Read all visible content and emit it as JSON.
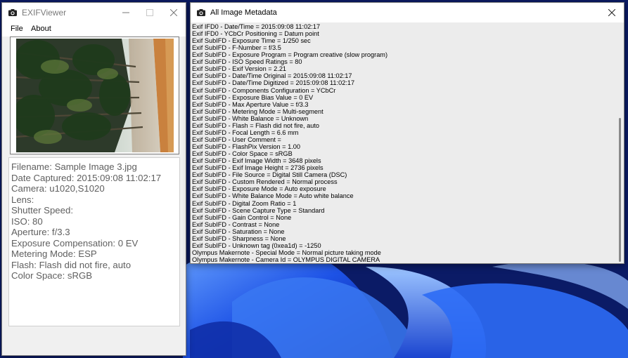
{
  "colors": {
    "wallpaper_dark": "#0a1a5c",
    "wallpaper_light": "#2a6cf0",
    "window_bg": "#f3f3f3",
    "meta_bg": "#ececec"
  },
  "exif_viewer": {
    "title": "EXIFViewer",
    "app_icon": "camera-icon",
    "menu": [
      "File",
      "About"
    ],
    "info": [
      "Filename: Sample Image 3.jpg",
      "Date Captured: 2015:09:08 11:02:17",
      "Camera: u1020,S1020",
      "Lens:",
      "Shutter Speed:",
      "ISO: 80",
      "Aperture: f/3.3",
      "Exposure Compensation: 0 EV",
      "Metering Mode: ESP",
      "Flash: Flash did not fire, auto",
      "Color Space: sRGB"
    ]
  },
  "metadata_window": {
    "title": "All Image Metadata",
    "app_icon": "camera-icon",
    "lines": [
      "Exif IFD0 - Date/Time = 2015:09:08 11:02:17",
      "Exif IFD0 - YCbCr Positioning = Datum point",
      "Exif SubIFD - Exposure Time = 1/250 sec",
      "Exif SubIFD - F-Number = f/3.5",
      "Exif SubIFD - Exposure Program = Program creative (slow program)",
      "Exif SubIFD - ISO Speed Ratings = 80",
      "Exif SubIFD - Exif Version = 2.21",
      "Exif SubIFD - Date/Time Original = 2015:09:08 11:02:17",
      "Exif SubIFD - Date/Time Digitized = 2015:09:08 11:02:17",
      "Exif SubIFD - Components Configuration = YCbCr",
      "Exif SubIFD - Exposure Bias Value = 0 EV",
      "Exif SubIFD - Max Aperture Value = f/3.3",
      "Exif SubIFD - Metering Mode = Multi-segment",
      "Exif SubIFD - White Balance = Unknown",
      "Exif SubIFD - Flash = Flash did not fire, auto",
      "Exif SubIFD - Focal Length = 6.6 mm",
      "Exif SubIFD - User Comment =",
      "Exif SubIFD - FlashPix Version = 1.00",
      "Exif SubIFD - Color Space = sRGB",
      "Exif SubIFD - Exif Image Width = 3648 pixels",
      "Exif SubIFD - Exif Image Height = 2736 pixels",
      "Exif SubIFD - File Source = Digital Still Camera (DSC)",
      "Exif SubIFD - Custom Rendered = Normal process",
      "Exif SubIFD - Exposure Mode = Auto exposure",
      "Exif SubIFD - White Balance Mode = Auto white balance",
      "Exif SubIFD - Digital Zoom Ratio = 1",
      "Exif SubIFD - Scene Capture Type = Standard",
      "Exif SubIFD - Gain Control = None",
      "Exif SubIFD - Contrast = None",
      "Exif SubIFD - Saturation = None",
      "Exif SubIFD - Sharpness = None",
      "Exif SubIFD - Unknown tag (0xea1d) = -1250",
      "Olympus Makernote - Special Mode = Normal picture taking mode",
      "Olympus Makernote - Camera Id = OLYMPUS DIGITAL CAMERA"
    ]
  }
}
